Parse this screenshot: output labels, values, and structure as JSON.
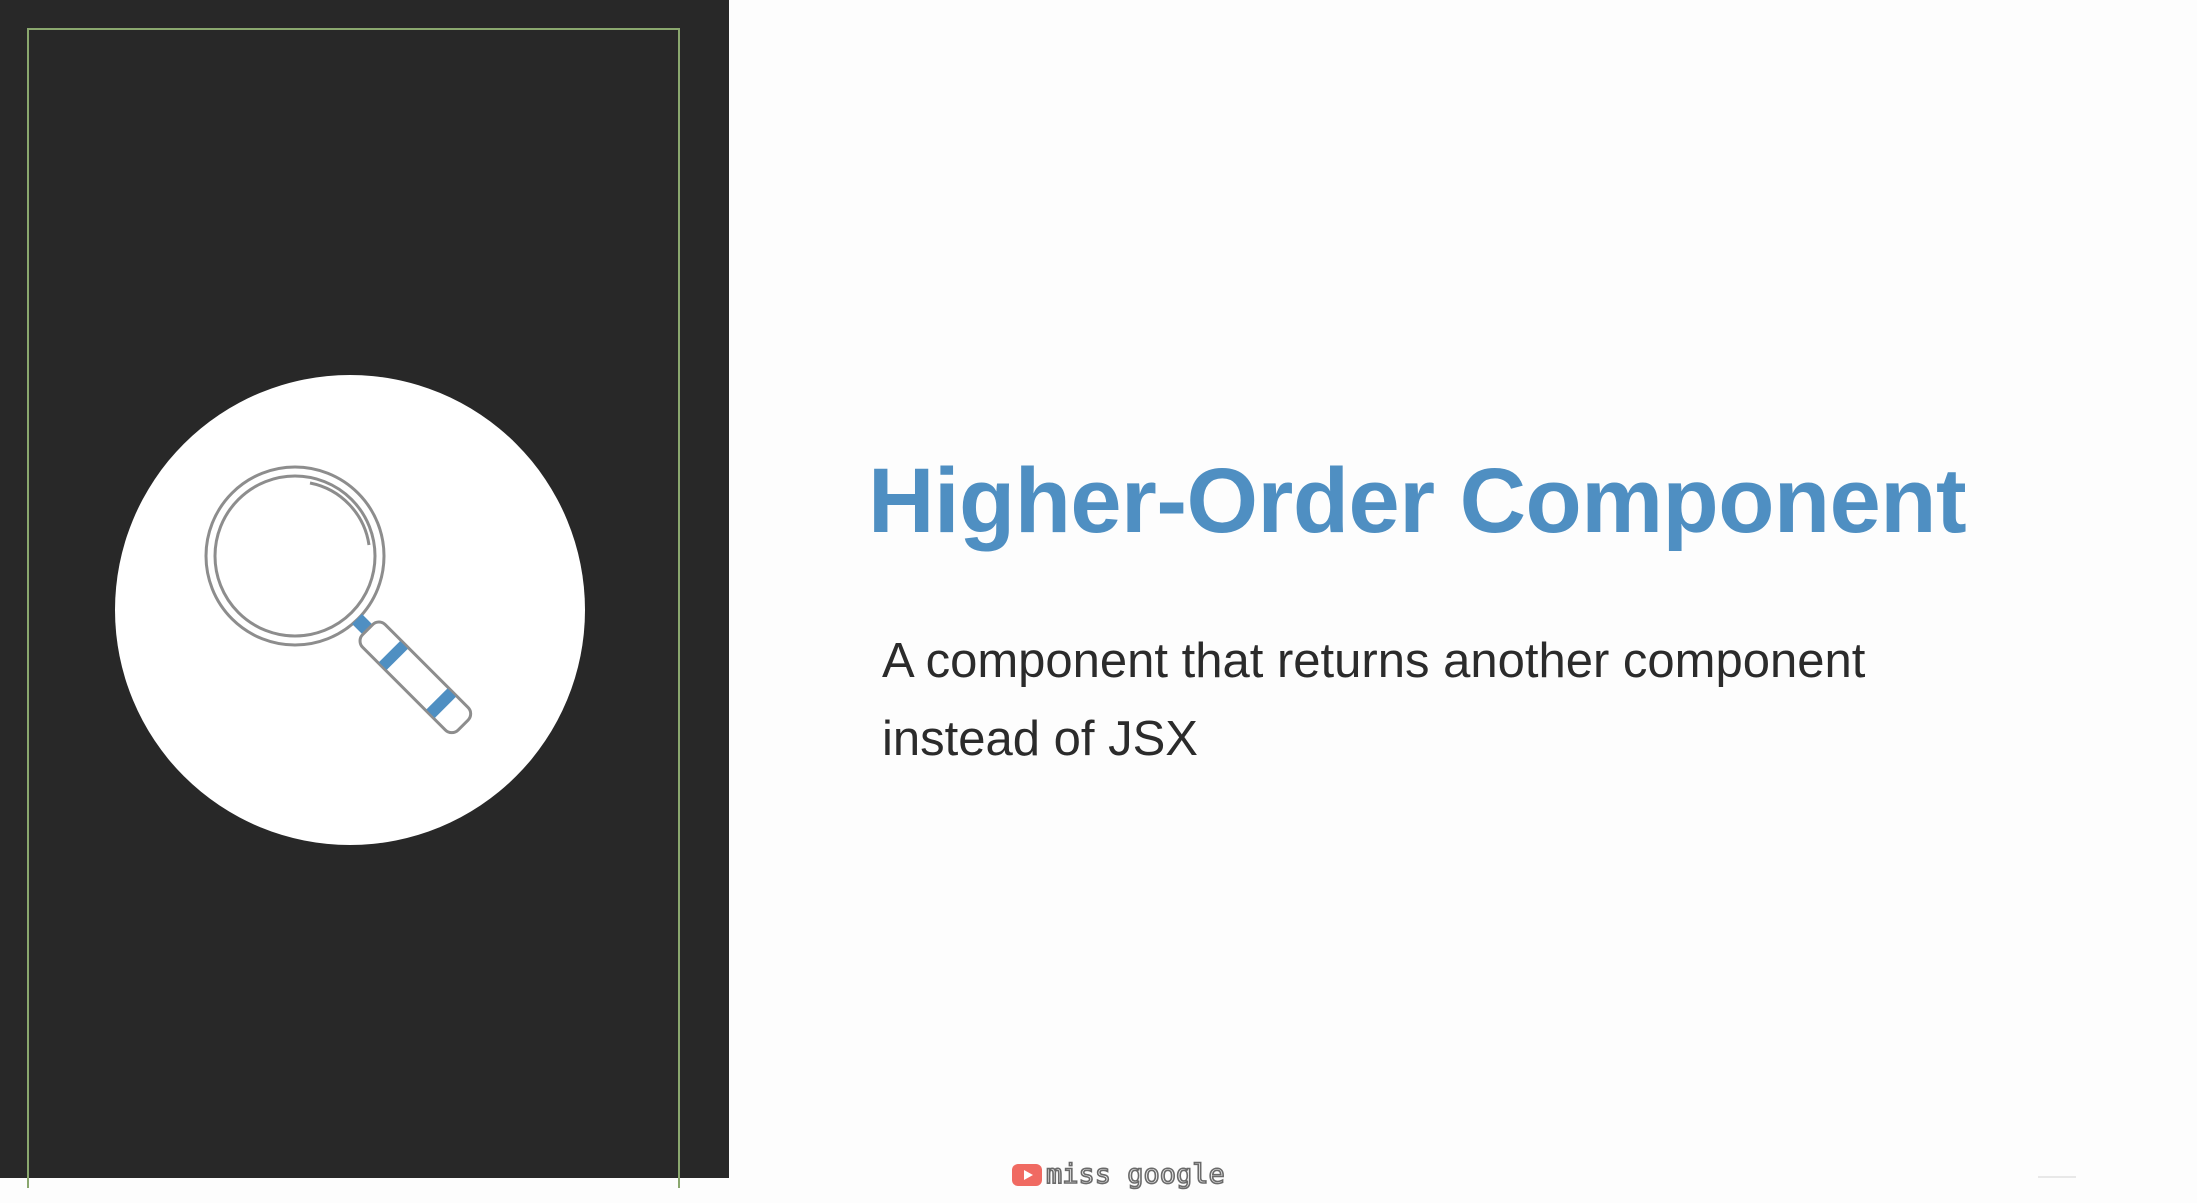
{
  "slide": {
    "title": "Higher-Order Component",
    "subtitle": "A component that returns another component instead of JSX",
    "icon": "magnifying-glass-icon"
  },
  "watermark": {
    "text": "miss google",
    "icon": "youtube-play-icon"
  },
  "colors": {
    "panel_bg": "#282828",
    "frame_border": "#8aa76e",
    "title": "#4f8fc2",
    "accent": "#4f8fc2",
    "body_text": "#2b2b2b",
    "youtube_red": "#f06a62"
  }
}
